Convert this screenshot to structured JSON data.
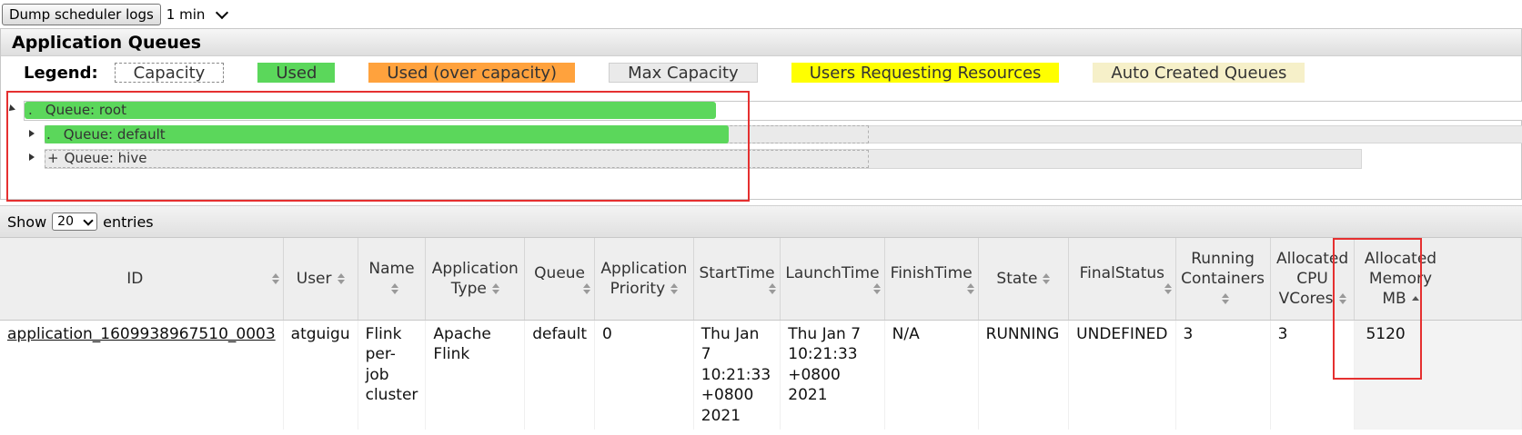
{
  "toolbar": {
    "dump_button": "Dump scheduler logs",
    "interval_value": "1 min"
  },
  "queues": {
    "title": "Application Queues",
    "legend_title": "Legend:",
    "legend": [
      "Capacity",
      "Used",
      "Used (over capacity)",
      "Max Capacity",
      "Users Requesting Resources",
      "Auto Created Queues"
    ],
    "tree": [
      {
        "label": "Queue: root",
        "used_fraction": 0.5,
        "expanded": true
      },
      {
        "label": "Queue: default",
        "used_fraction": 0.5,
        "expanded": false
      },
      {
        "label": "Queue: hive",
        "used_fraction": 0.0,
        "expanded": false
      }
    ],
    "colors": {
      "used": "#5bd75b",
      "over": "#ffa23d",
      "users": "#ffff00",
      "auto": "#f6f0c9",
      "highlight": "#e53030"
    }
  },
  "entries": {
    "show_label": "Show",
    "page_size": "20",
    "entries_label": "entries"
  },
  "table": {
    "headers": {
      "id": "ID",
      "user": "User",
      "name": "Name",
      "app_type": "Application Type",
      "queue": "Queue",
      "priority": "Application Priority",
      "start": "StartTime",
      "launch": "LaunchTime",
      "finish": "FinishTime",
      "state": "State",
      "final": "FinalStatus",
      "containers": "Running Containers",
      "vcores": "Allocated CPU VCores",
      "memory": "Allocated Memory MB"
    },
    "rows": [
      {
        "id": "application_1609938967510_0003",
        "user": "atguigu",
        "name": "Flink per-job cluster",
        "app_type": "Apache Flink",
        "queue": "default",
        "priority": "0",
        "start": "Thu Jan 7 10:21:33 +0800 2021",
        "launch": "Thu Jan 7 10:21:33 +0800 2021",
        "finish": "N/A",
        "state": "RUNNING",
        "final": "UNDEFINED",
        "containers": "3",
        "vcores": "3",
        "memory": "5120"
      }
    ]
  }
}
